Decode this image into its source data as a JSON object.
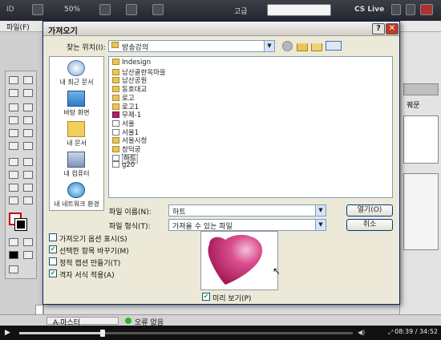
{
  "app": {
    "zoom": "50%",
    "workspace": "고급",
    "cs_live": "CS Live",
    "menu_file": "파일(F)",
    "page_ruler": "A-마스터",
    "status_errors": "오류 없음",
    "right_panel_label": "퀘문"
  },
  "video": {
    "time": "08:39 / 34:52",
    "progress_fraction": 0.25
  },
  "dialog": {
    "title": "가져오기",
    "look_in_label": "찾는 위치(I):",
    "look_in_value": "방송강의",
    "places": [
      "내 최근 문서",
      "바탕 화면",
      "내 문서",
      "내 컴퓨터",
      "내 네트워크 환경"
    ],
    "files": [
      {
        "name": "Indesign",
        "type": "folder"
      },
      {
        "name": "남산골한옥마을",
        "type": "folder"
      },
      {
        "name": "남산공원",
        "type": "folder"
      },
      {
        "name": "동호대교",
        "type": "folder"
      },
      {
        "name": "로고",
        "type": "folder"
      },
      {
        "name": "로고1",
        "type": "folder"
      },
      {
        "name": "무제-1",
        "type": "indd"
      },
      {
        "name": "서울",
        "type": "doc"
      },
      {
        "name": "서울1",
        "type": "doc"
      },
      {
        "name": "서울시청",
        "type": "folder"
      },
      {
        "name": "창덕궁",
        "type": "folder"
      },
      {
        "name": "하트",
        "type": "doc"
      },
      {
        "name": "g20",
        "type": "doc"
      }
    ],
    "selected_file": "하트",
    "filename_label": "파일 이름(N):",
    "filename_value": "하트",
    "filetype_label": "파일 형식(T):",
    "filetype_value": "가져올 수 있는 파일",
    "open_button": "열기(O)",
    "cancel_button": "취소",
    "options": [
      {
        "label": "가져오기 옵션 표시(S)",
        "checked": false
      },
      {
        "label": "선택한 항목 바꾸기(M)",
        "checked": true
      },
      {
        "label": "정적 캡션 만들기(T)",
        "checked": false
      },
      {
        "label": "격자 서식 적용(A)",
        "checked": true
      }
    ],
    "preview_label": "미리 보기(P)",
    "preview_checked": true
  },
  "colors": {
    "heart": "#c2185b",
    "dialog_bg": "#ece9d8",
    "close": "#c23b22"
  }
}
